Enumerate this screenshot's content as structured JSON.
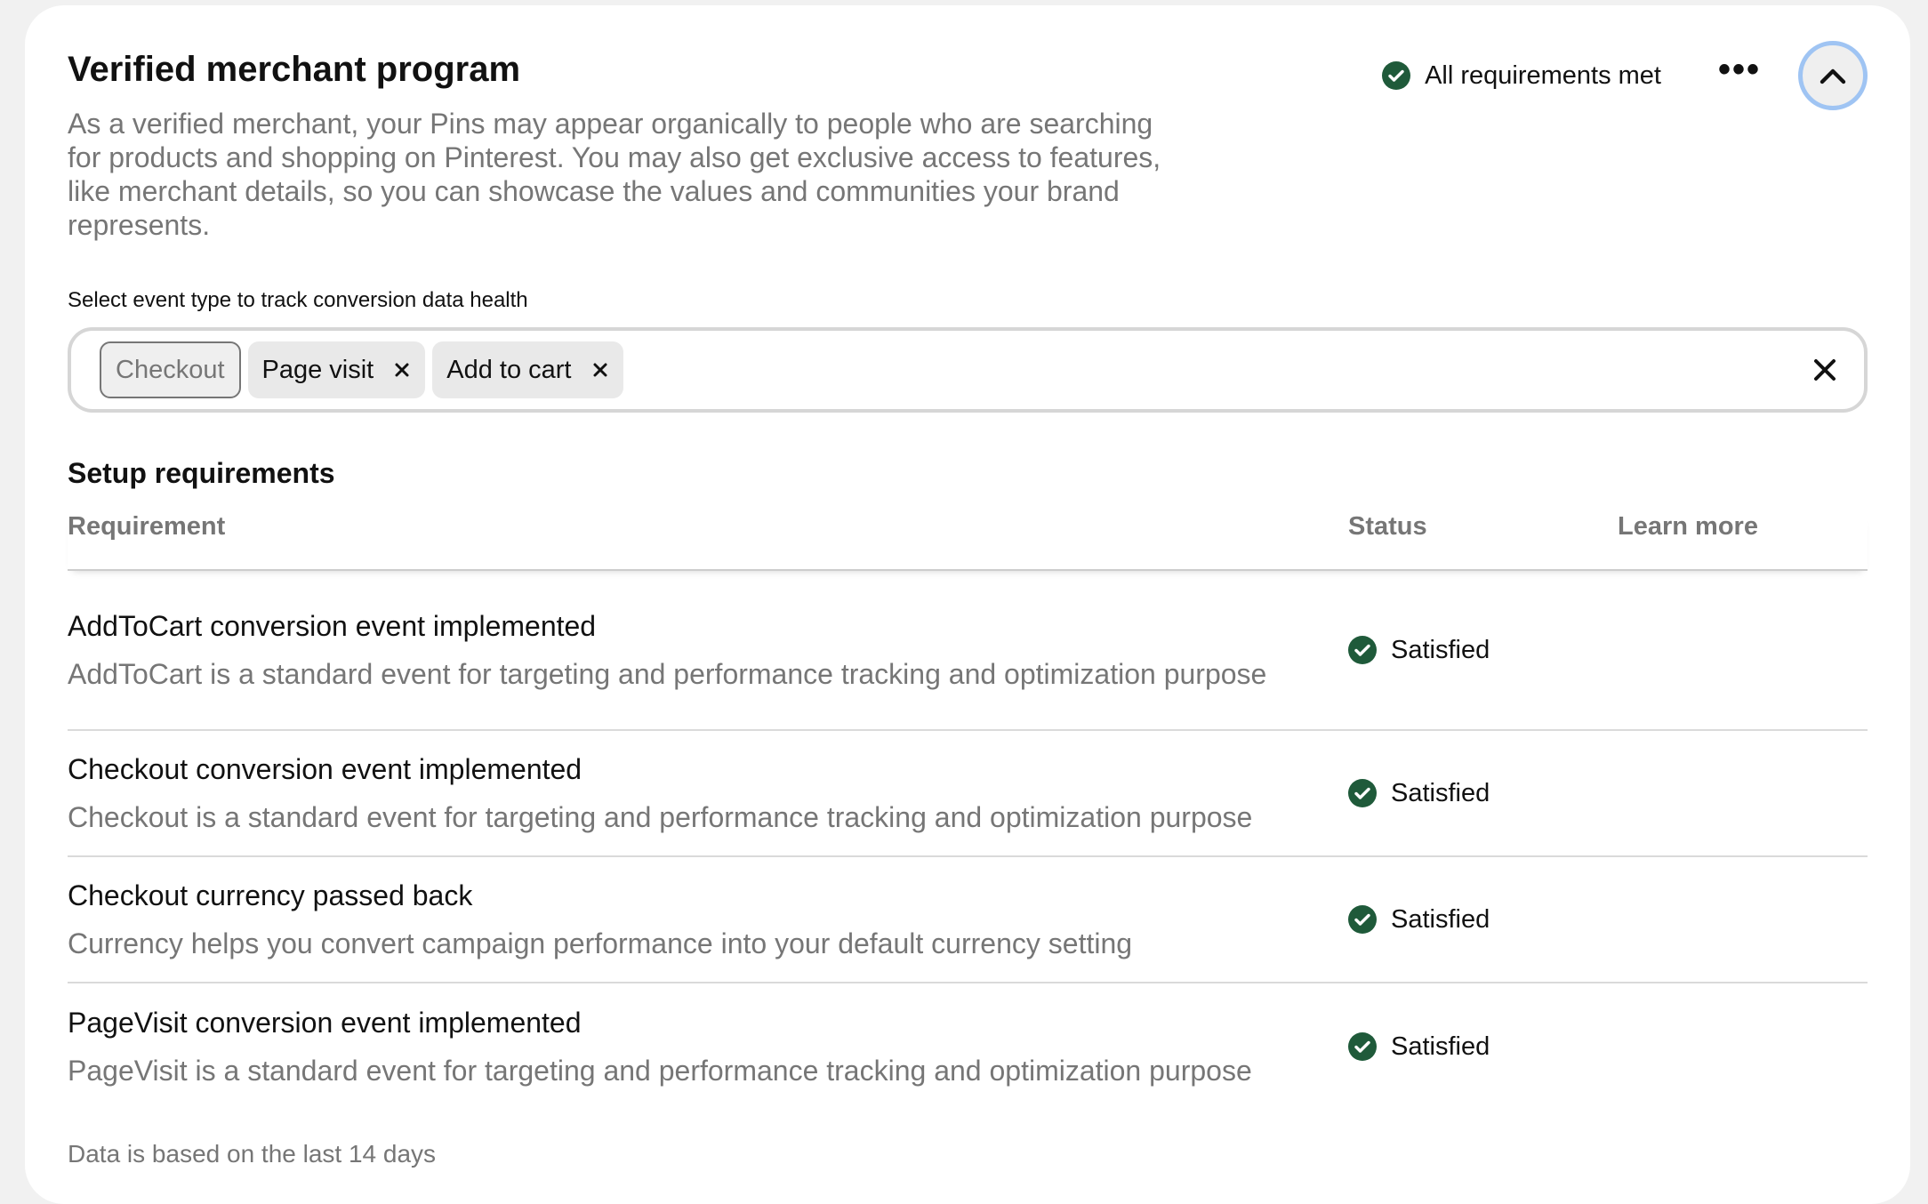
{
  "program": {
    "title": "Verified merchant program",
    "description": "As a verified merchant, your Pins may appear organically to people who are searching for products and shopping on Pinterest. You may also get exclusive access to features, like merchant details, so you can showcase the values and communities your brand represents.",
    "status_summary": "All requirements met",
    "more_icon": "more-horizontal-icon",
    "collapse_icon": "chevron-up-icon"
  },
  "event_select": {
    "label": "Select event type to track conversion data health",
    "tags": [
      {
        "label": "Checkout",
        "removable": false
      },
      {
        "label": "Page visit",
        "removable": true
      },
      {
        "label": "Add to cart",
        "removable": true
      }
    ],
    "clear_icon": "close-icon"
  },
  "requirements": {
    "section_title": "Setup requirements",
    "columns": [
      "Requirement",
      "Status",
      "Learn more"
    ],
    "rows": [
      {
        "title": "AddToCart conversion event implemented",
        "description": "AddToCart is a standard event for targeting and performance tracking and optimization purpose",
        "status": "Satisfied"
      },
      {
        "title": "Checkout conversion event implemented",
        "description": "Checkout is a standard event for targeting and performance tracking and optimization purpose",
        "status": "Satisfied"
      },
      {
        "title": "Checkout currency passed back",
        "description": "Currency helps you convert campaign performance into your default currency setting",
        "status": "Satisfied"
      },
      {
        "title": "PageVisit conversion event implemented",
        "description": "PageVisit is a standard event for targeting and performance tracking and optimization purpose",
        "status": "Satisfied"
      }
    ]
  },
  "footnote": "Data is based on the last 14 days",
  "colors": {
    "success": "#1f5a3a",
    "muted_text": "#767676",
    "focus_ring": "#9fc4f3"
  }
}
